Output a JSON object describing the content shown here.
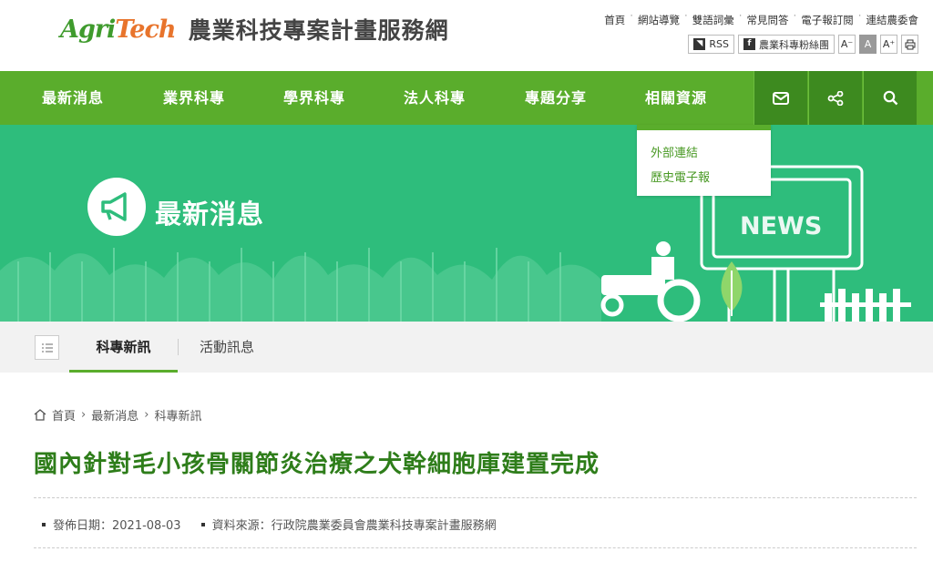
{
  "logo": {
    "part1": "Agri",
    "part2": "Tech"
  },
  "site_title": "農業科技專案計畫服務網",
  "top_links": [
    "首頁",
    "網站導覽",
    "雙語詞彙",
    "常見問答",
    "電子報訂閱",
    "連結農委會"
  ],
  "tools": {
    "rss": "RSS",
    "facebook": "農業科專粉絲團",
    "font_small": "A⁻",
    "font_mid": "A",
    "font_large": "A⁺"
  },
  "nav": [
    "最新消息",
    "業界科專",
    "學界科專",
    "法人科專",
    "專題分享",
    "相關資源"
  ],
  "dropdown": [
    "外部連結",
    "歷史電子報"
  ],
  "banner": {
    "title": "最新消息",
    "sign": "NEWS"
  },
  "tabs": [
    "科專新訊",
    "活動訊息"
  ],
  "breadcrumb": [
    "首頁",
    "最新消息",
    "科專新訊"
  ],
  "article": {
    "title": "國內針對毛小孩骨關節炎治療之犬幹細胞庫建置完成",
    "date_label": "發佈日期：2021-08-03",
    "source_label": "資料來源：行政院農業委員會農業科技專案計畫服務網"
  },
  "colors": {
    "nav_green": "#5aad2c",
    "banner_green": "#2ebd7c",
    "title_green": "#2e7d1a"
  }
}
